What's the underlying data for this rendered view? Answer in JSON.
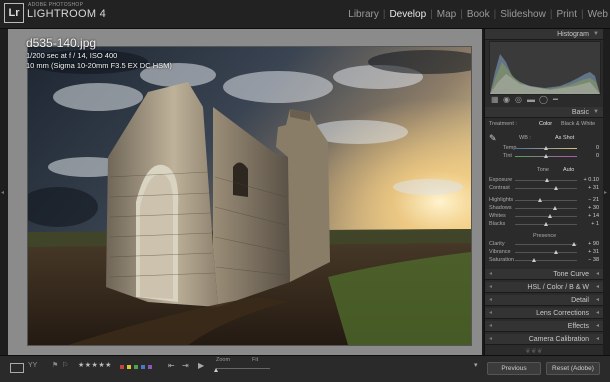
{
  "app": {
    "logo_text": "Lr",
    "brand_small": "ADOBE PHOTOSHOP",
    "brand_big": "LIGHTROOM 4"
  },
  "modules": [
    {
      "label": "Library",
      "active": false
    },
    {
      "label": "Develop",
      "active": true
    },
    {
      "label": "Map",
      "active": false
    },
    {
      "label": "Book",
      "active": false
    },
    {
      "label": "Slideshow",
      "active": false
    },
    {
      "label": "Print",
      "active": false
    },
    {
      "label": "Web",
      "active": false
    }
  ],
  "photo_info": {
    "filename": "d535-140.jpg",
    "exposure_line": "1/200 sec at f / 14, ISO 400",
    "lens_line": "10 mm (Sigma 10-20mm F3.5 EX DC HSM)"
  },
  "histogram": {
    "title": "Histogram",
    "iso": "ISO 400",
    "focal": "10 mm",
    "aperture": "f / 14",
    "shutter": "1/200 sec"
  },
  "basic": {
    "title": "Basic",
    "treatment_label": "Treatment :",
    "color_label": "Color",
    "bw_label": "Black & White",
    "wb_label": "WB :",
    "wb_value": "As Shot",
    "temp_label": "Temp",
    "temp_value": "0",
    "temp_pos": 0.5,
    "tint_label": "Tint",
    "tint_value": "0",
    "tint_pos": 0.5,
    "tone_label": "Tone",
    "auto_label": "Auto",
    "exposure_label": "Exposure",
    "exposure_value": "+ 0.10",
    "exposure_pos": 0.52,
    "contrast_label": "Contrast",
    "contrast_value": "+ 31",
    "contrast_pos": 0.66,
    "highlights_label": "Highlights",
    "highlights_value": "− 21",
    "highlights_pos": 0.4,
    "shadows_label": "Shadows",
    "shadows_value": "+ 30",
    "shadows_pos": 0.65,
    "whites_label": "Whites",
    "whites_value": "+ 14",
    "whites_pos": 0.57,
    "blacks_label": "Blacks",
    "blacks_value": "+ 1",
    "blacks_pos": 0.5,
    "presence_label": "Presence",
    "clarity_label": "Clarity",
    "clarity_value": "+ 90",
    "clarity_pos": 0.95,
    "vibrance_label": "Vibrance",
    "vibrance_value": "+ 31",
    "vibrance_pos": 0.66,
    "saturation_label": "Saturation",
    "saturation_value": "− 38",
    "saturation_pos": 0.31
  },
  "panels": {
    "tone_curve": "Tone Curve",
    "hsl": "HSL  /  Color  /  B & W",
    "detail": "Detail",
    "lens_corrections": "Lens Corrections",
    "effects": "Effects",
    "camera_calibration": "Camera Calibration"
  },
  "toolbar": {
    "stars": "★★★★★",
    "play": "▶",
    "zoom_label": "Zoom",
    "fit_label": "Fit",
    "zoom_pos": 0.0,
    "previous_label": "Previous",
    "reset_label": "Reset (Adobe)",
    "swatches": [
      "#c8423e",
      "#d9c53a",
      "#4fa34b",
      "#4b78c2",
      "#8a58b8"
    ]
  }
}
